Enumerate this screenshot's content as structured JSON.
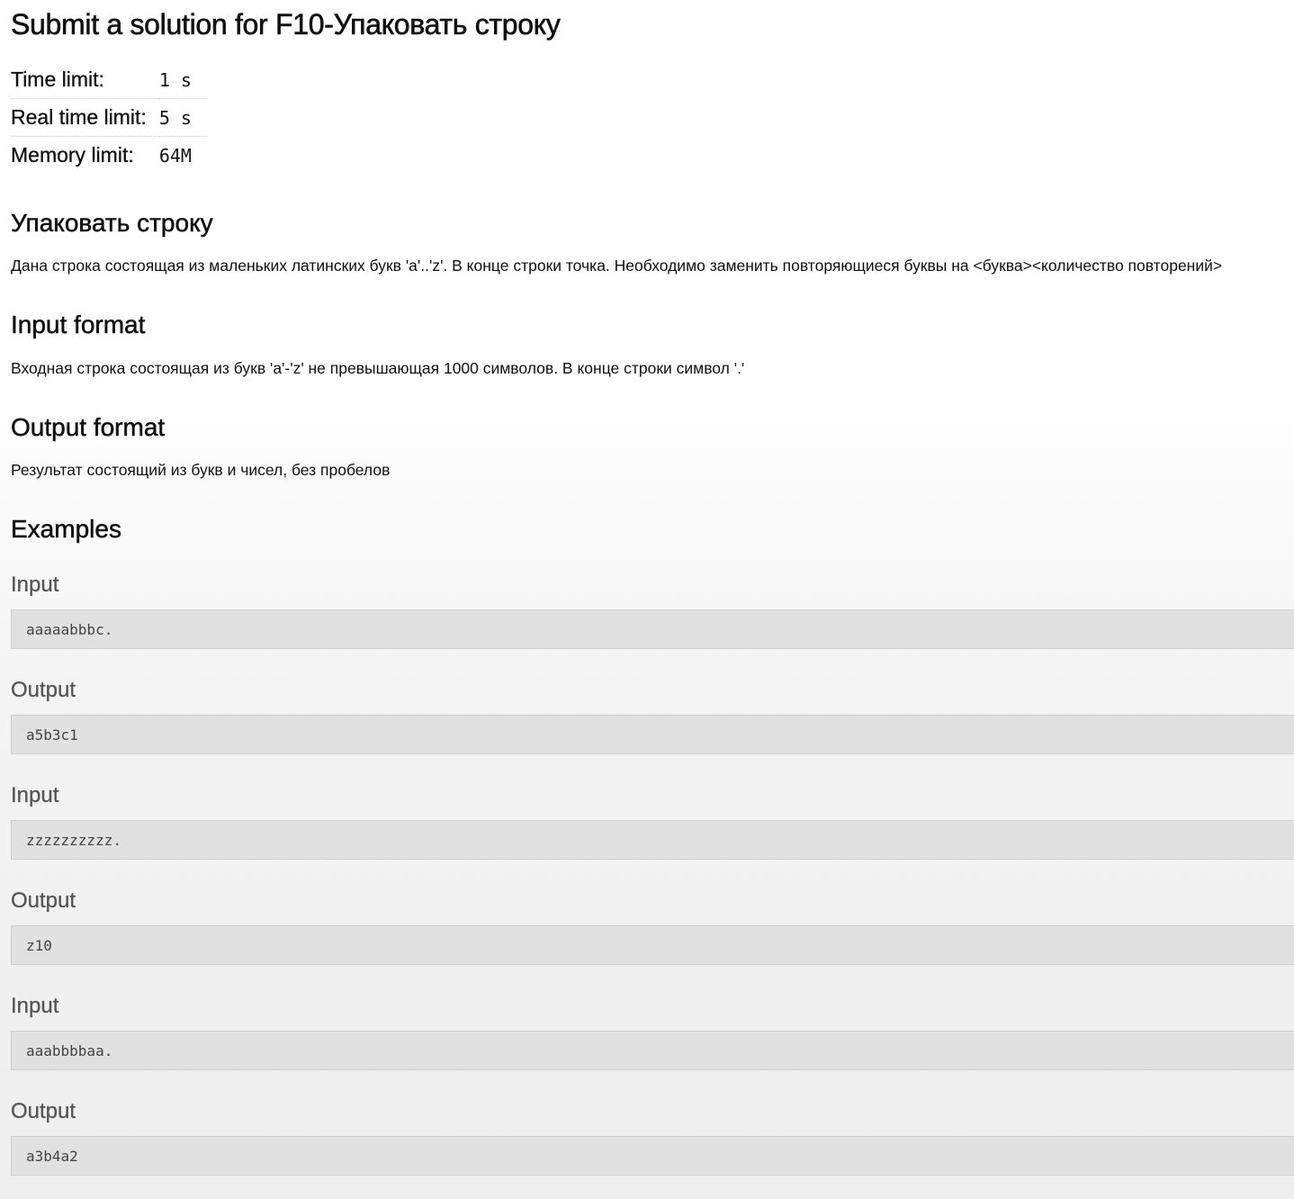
{
  "header": {
    "title": "Submit a solution for F10-Упаковать строку"
  },
  "limits": [
    {
      "label": "Time limit:",
      "value": "1 s"
    },
    {
      "label": "Real time limit:",
      "value": "5 s"
    },
    {
      "label": "Memory limit:",
      "value": "64M"
    }
  ],
  "problem": {
    "title": "Упаковать строку",
    "statement": "Дана строка состоящая из маленьких латинских букв 'a'..'z'. В конце строки точка. Необходимо заменить повторяющиеся буквы на <буква><количество повторений>"
  },
  "input_format": {
    "title": "Input format",
    "text": "Входная строка состоящая из букв 'a'-'z' не превышающая 1000 символов. В конце строки символ '.'"
  },
  "output_format": {
    "title": "Output format",
    "text": "Результат состоящий из букв и чисел, без пробелов"
  },
  "examples": {
    "title": "Examples",
    "items": [
      {
        "input_label": "Input",
        "input": "aaaaabbbc.",
        "output_label": "Output",
        "output": "a5b3c1"
      },
      {
        "input_label": "Input",
        "input": "zzzzzzzzzz.",
        "output_label": "Output",
        "output": "z10"
      },
      {
        "input_label": "Input",
        "input": "aaabbbbaa.",
        "output_label": "Output",
        "output": "a3b4a2"
      }
    ]
  }
}
